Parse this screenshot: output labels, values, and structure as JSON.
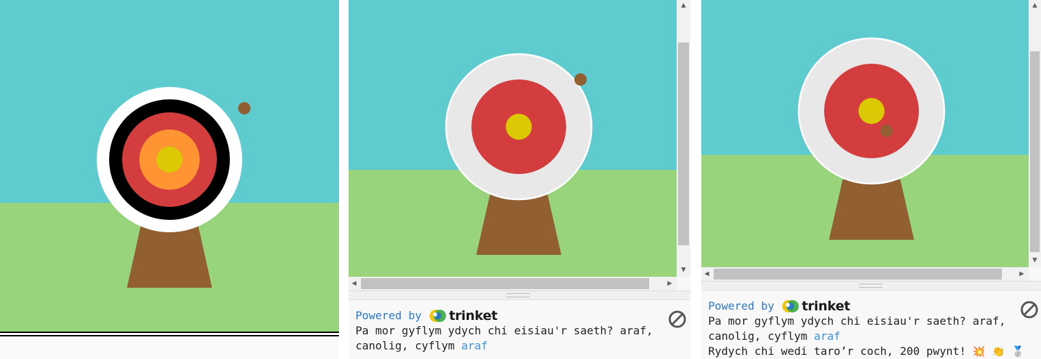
{
  "panels": [
    {
      "id": "panel-1",
      "description_type": "archery-target-scene",
      "target_rings": [
        "white",
        "black",
        "red",
        "orange",
        "yellow"
      ]
    },
    {
      "id": "panel-2",
      "console": {
        "powered_by": "Powered by",
        "brand": "trinket",
        "prompt_line1": "Pa mor gyflym ydych chi eisiau'r saeth? araf,",
        "prompt_line2_prefix": "canolig, cyflym ",
        "answer": "araf"
      }
    },
    {
      "id": "panel-3",
      "console": {
        "powered_by": "Powered by",
        "brand": "trinket",
        "prompt_line1": "Pa mor gyflym ydych chi eisiau'r saeth? araf,",
        "prompt_line2_prefix": "canolig, cyflym ",
        "answer": "araf",
        "result": "Rydych chi wedi taro’r coch, 200 pwynt!",
        "emoji": [
          "💥",
          "👏",
          "🥈"
        ]
      }
    }
  ],
  "colors": {
    "sky": "#5ecbcf",
    "grass": "#97d47c",
    "stand": "#925f32",
    "arrow": "#925f32",
    "ring_white": "#ffffff",
    "ring_grey": "#e8e8e8",
    "ring_black": "#000000",
    "ring_red": "#d33d3d",
    "ring_orange": "#ff9432",
    "ring_yellow": "#dcc906",
    "link_blue": "#2a78c8"
  },
  "icons": {
    "stop": "stop-circle-icon",
    "trinket_logo": "trinket-logo-icon",
    "scroll_up": "chevron-up-icon",
    "scroll_down": "chevron-down-icon",
    "scroll_left": "chevron-left-icon",
    "scroll_right": "chevron-right-icon"
  }
}
